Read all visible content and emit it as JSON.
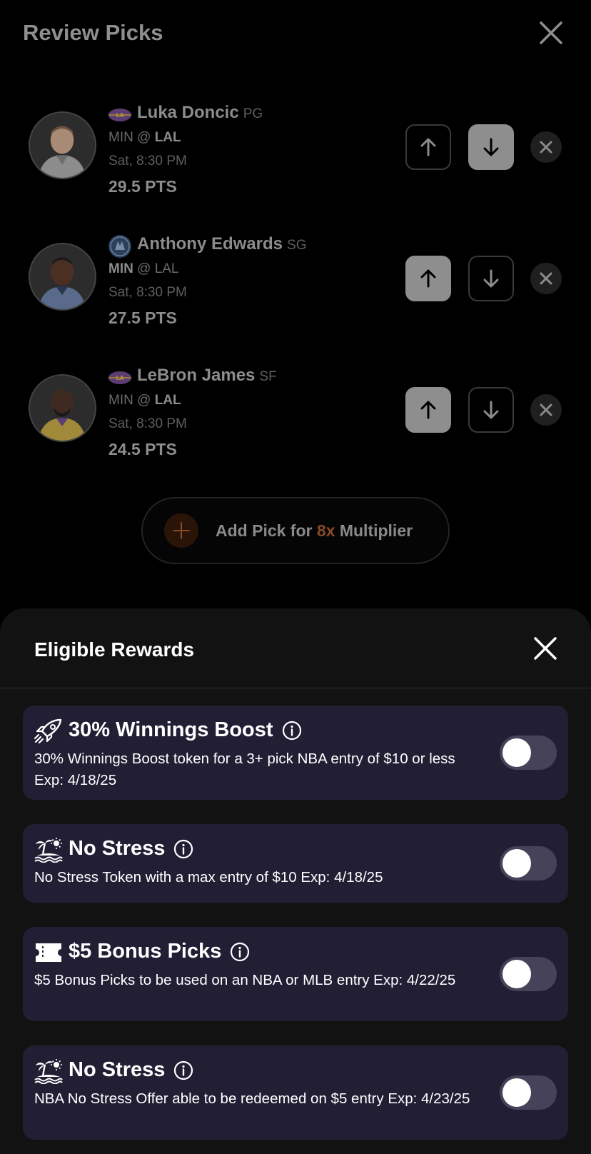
{
  "review": {
    "title": "Review Picks",
    "picks": [
      {
        "name": "Luka Doncic",
        "position": "PG",
        "away": "MIN",
        "at": "@",
        "home": "LAL",
        "bold_team": "home",
        "time": "Sat, 8:30 PM",
        "line": "29.5 PTS",
        "selected": "down",
        "team_icon": "lakers-logo-icon"
      },
      {
        "name": "Anthony Edwards",
        "position": "SG",
        "away": "MIN",
        "at": "@",
        "home": "LAL",
        "bold_team": "away",
        "time": "Sat, 8:30 PM",
        "line": "27.5 PTS",
        "selected": "up",
        "team_icon": "timberwolves-logo-icon"
      },
      {
        "name": "LeBron James",
        "position": "SF",
        "away": "MIN",
        "at": "@",
        "home": "LAL",
        "bold_team": "home",
        "time": "Sat, 8:30 PM",
        "line": "24.5 PTS",
        "selected": "up",
        "team_icon": "lakers-logo-icon"
      }
    ],
    "add_pick": {
      "prefix": "Add Pick for",
      "multiplier": "8x",
      "suffix": "Multiplier"
    }
  },
  "sheet": {
    "title": "Eligible Rewards",
    "rewards": [
      {
        "icon": "rocket-icon",
        "title": "30% Winnings Boost",
        "description": "30% Winnings Boost token for a 3+ pick NBA entry of $10 or less Exp: 4/18/25",
        "enabled": false
      },
      {
        "icon": "island-icon",
        "title": "No Stress",
        "description": "No Stress Token with a max entry of $10 Exp: 4/18/25",
        "enabled": false
      },
      {
        "icon": "ticket-icon",
        "title": "$5 Bonus Picks",
        "description": "$5 Bonus Picks to be used on an NBA or MLB entry Exp: 4/22/25",
        "enabled": false
      },
      {
        "icon": "island-icon",
        "title": "No Stress",
        "description": "NBA No Stress Offer able to be redeemed on $5 entry Exp: 4/23/25",
        "enabled": false
      }
    ]
  },
  "colors": {
    "background": "#000000",
    "sheet": "#121212",
    "card": "#221f35",
    "toggle_off": "#45425a",
    "accent": "#8a4a26"
  }
}
